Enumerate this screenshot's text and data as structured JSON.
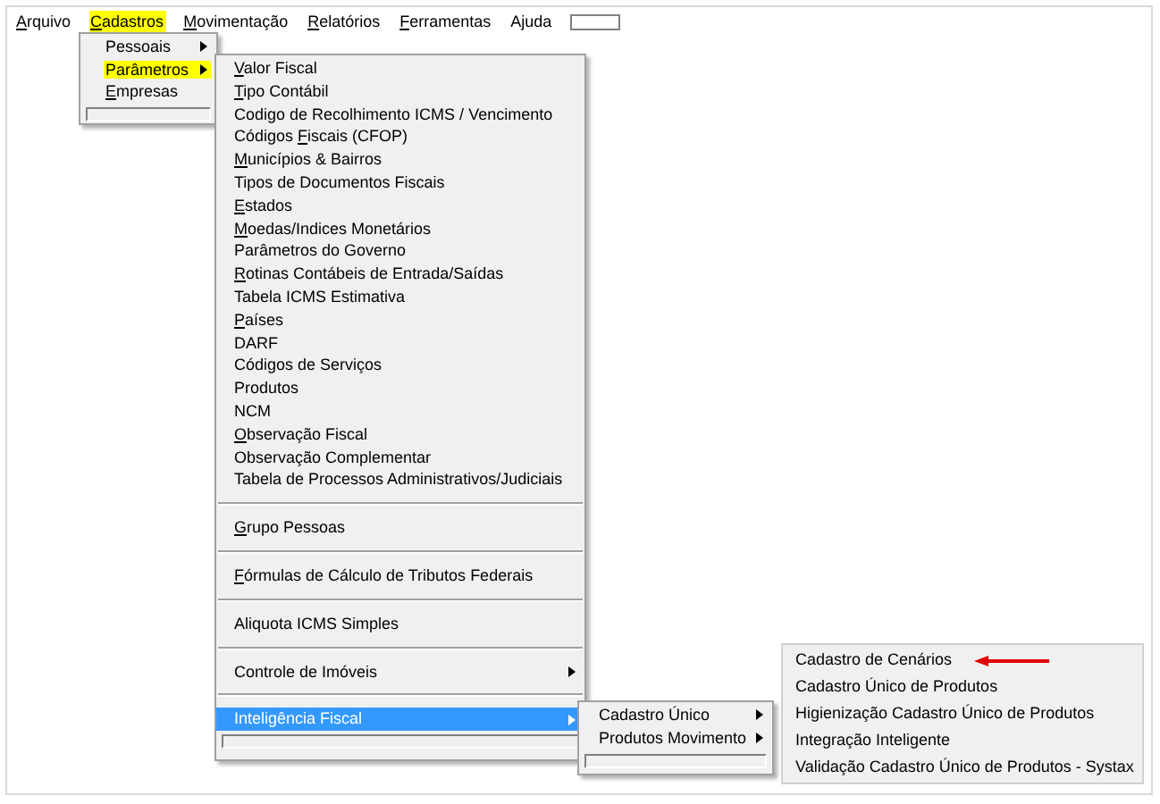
{
  "menu_bar": [
    {
      "key": "A",
      "post": "rquivo",
      "highlighted": false
    },
    {
      "key": "C",
      "post": "adastros",
      "highlighted": true
    },
    {
      "key": "M",
      "post": "ovimentação",
      "highlighted": false
    },
    {
      "key": "R",
      "post": "elatórios",
      "highlighted": false
    },
    {
      "key": "F",
      "post": "erramentas",
      "highlighted": false
    },
    {
      "label": "Ajuda",
      "highlighted": false
    }
  ],
  "cadastros_menu": [
    {
      "label": "Pessoais",
      "highlighted": false,
      "submenu": true
    },
    {
      "label": "Parâmetros",
      "highlighted": true,
      "submenu": true
    },
    {
      "key": "E",
      "post": "mpresas",
      "highlighted": false,
      "submenu": false
    }
  ],
  "parametros_menu": [
    [
      {
        "key": "V",
        "post": "alor Fiscal",
        "selected": false,
        "submenu": false
      },
      {
        "key": "T",
        "post": "ipo Contábil",
        "selected": false,
        "submenu": false
      },
      {
        "label": "Codigo de Recolhimento ICMS / Vencimento",
        "selected": false,
        "submenu": false
      },
      {
        "pre": "Códigos ",
        "key": "F",
        "post": "iscais  (CFOP)",
        "selected": false,
        "submenu": false
      },
      {
        "key": "M",
        "post": "unicípios & Bairros",
        "selected": false,
        "submenu": false
      },
      {
        "label": "Tipos de Documentos Fiscais",
        "selected": false,
        "submenu": false
      },
      {
        "key": "E",
        "post": "stados",
        "selected": false,
        "submenu": false
      },
      {
        "key": "M",
        "post": "oedas/Indices Monetários",
        "selected": false,
        "submenu": false
      },
      {
        "label": "Parâmetros do Governo",
        "selected": false,
        "submenu": false
      },
      {
        "key": "R",
        "post": "otinas Contábeis de Entrada/Saídas",
        "selected": false,
        "submenu": false
      },
      {
        "label": "Tabela ICMS Estimativa",
        "selected": false,
        "submenu": false
      },
      {
        "key": "P",
        "post": "aíses",
        "selected": false,
        "submenu": false
      },
      {
        "label": "DARF",
        "selected": false,
        "submenu": false
      },
      {
        "label": "Códigos de Serviços",
        "selected": false,
        "submenu": false
      },
      {
        "label": "Produtos",
        "selected": false,
        "submenu": false
      },
      {
        "label": "NCM",
        "selected": false,
        "submenu": false
      },
      {
        "key": "O",
        "post": "bservação Fiscal",
        "selected": false,
        "submenu": false
      },
      {
        "label": "Observação Complementar",
        "selected": false,
        "submenu": false
      },
      {
        "label": "Tabela de Processos Administrativos/Judiciais",
        "selected": false,
        "submenu": false
      }
    ],
    [
      {
        "key": "G",
        "post": "rupo Pessoas",
        "selected": false,
        "submenu": false
      }
    ],
    [
      {
        "key": "F",
        "post": "órmulas de Cálculo de Tributos Federais",
        "selected": false,
        "submenu": false
      }
    ],
    [
      {
        "label": "Aliquota ICMS Simples",
        "selected": false,
        "submenu": false
      }
    ],
    [
      {
        "label": "Controle de Imóveis",
        "selected": false,
        "submenu": true
      }
    ],
    [
      {
        "label": "Inteligência Fiscal",
        "selected": true,
        "submenu": true
      }
    ]
  ],
  "inteligencia_menu": [
    {
      "label": "Cadastro Único",
      "selected": false,
      "submenu": true
    },
    {
      "label": "Produtos Movimento",
      "selected": false,
      "submenu": true
    }
  ],
  "cadastro_unico_menu": [
    {
      "label": "Cadastro de Cenários",
      "pointed": true
    },
    {
      "label": "Cadastro Único de Produtos",
      "pointed": false
    },
    {
      "label": "Higienização Cadastro Único de Produtos",
      "pointed": false
    },
    {
      "label": "Integração Inteligente",
      "pointed": false
    },
    {
      "label": "Validação Cadastro Único de Produtos - Systax",
      "pointed": false
    }
  ]
}
